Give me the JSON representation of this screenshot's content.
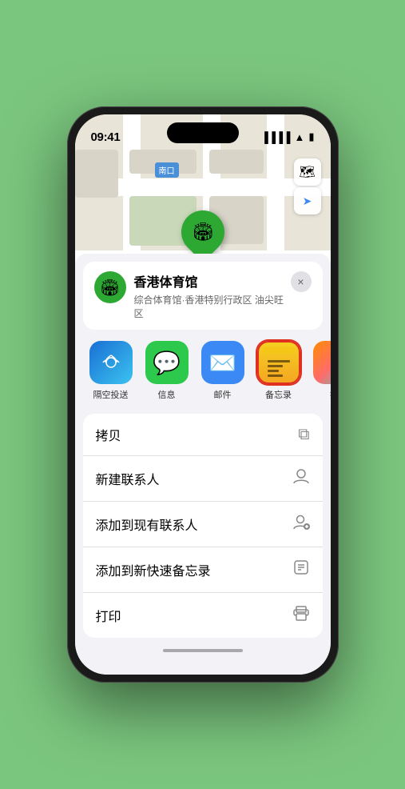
{
  "statusBar": {
    "time": "09:41",
    "signal": "●●●●",
    "wifi": "WiFi",
    "battery": "Battery"
  },
  "map": {
    "label": "南口",
    "pin_label": "香港体育馆"
  },
  "mapControls": {
    "layers_icon": "🗺",
    "location_icon": "➤"
  },
  "locationCard": {
    "name": "香港体育馆",
    "subtitle": "综合体育馆·香港特别行政区 油尖旺区",
    "close_label": "×"
  },
  "shareItems": [
    {
      "id": "airdrop",
      "label": "隔空投送",
      "type": "airdrop"
    },
    {
      "id": "messages",
      "label": "信息",
      "type": "messages"
    },
    {
      "id": "mail",
      "label": "邮件",
      "type": "mail"
    },
    {
      "id": "notes",
      "label": "备忘录",
      "type": "notes"
    },
    {
      "id": "more",
      "label": "推",
      "type": "more"
    }
  ],
  "actions": [
    {
      "id": "copy",
      "label": "拷贝",
      "icon": "⧉"
    },
    {
      "id": "new-contact",
      "label": "新建联系人",
      "icon": "👤"
    },
    {
      "id": "add-existing",
      "label": "添加到现有联系人",
      "icon": "👤"
    },
    {
      "id": "add-notes",
      "label": "添加到新快速备忘录",
      "icon": "📋"
    },
    {
      "id": "print",
      "label": "打印",
      "icon": "🖨"
    }
  ]
}
